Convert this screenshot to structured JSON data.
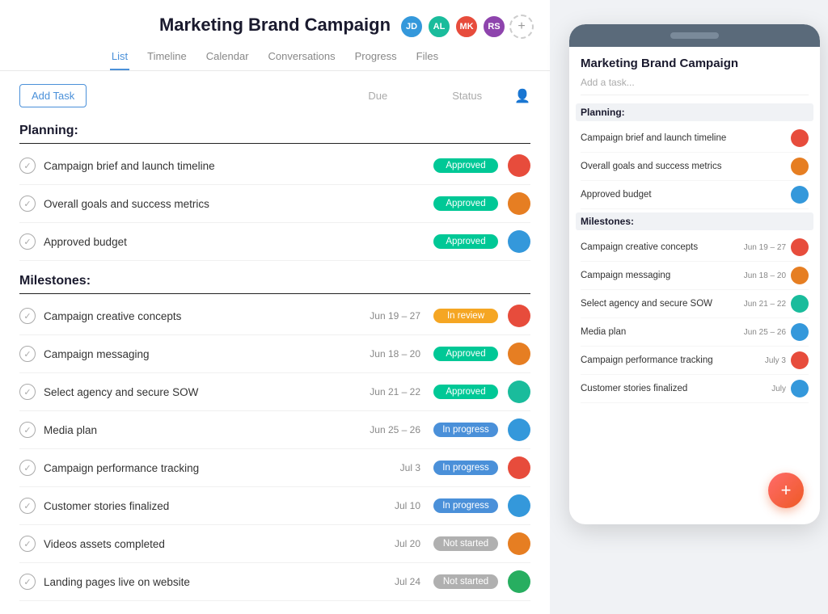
{
  "header": {
    "title": "Marketing Brand Campaign",
    "add_task_label": "Add Task",
    "col_due": "Due",
    "col_status": "Status"
  },
  "tabs": [
    {
      "label": "List",
      "active": true
    },
    {
      "label": "Timeline",
      "active": false
    },
    {
      "label": "Calendar",
      "active": false
    },
    {
      "label": "Conversations",
      "active": false
    },
    {
      "label": "Progress",
      "active": false
    },
    {
      "label": "Files",
      "active": false
    }
  ],
  "sections": [
    {
      "title": "Planning:",
      "tasks": [
        {
          "name": "Campaign brief and launch timeline",
          "due": "",
          "status": "Approved",
          "status_class": "badge-approved",
          "avatar_color": "av-red"
        },
        {
          "name": "Overall goals and success metrics",
          "due": "",
          "status": "Approved",
          "status_class": "badge-approved",
          "avatar_color": "av-orange"
        },
        {
          "name": "Approved budget",
          "due": "",
          "status": "Approved",
          "status_class": "badge-approved",
          "avatar_color": "av-blue"
        }
      ]
    },
    {
      "title": "Milestones:",
      "tasks": [
        {
          "name": "Campaign creative concepts",
          "due": "Jun 19 – 27",
          "status": "In review",
          "status_class": "badge-inreview",
          "avatar_color": "av-red"
        },
        {
          "name": "Campaign messaging",
          "due": "Jun 18 – 20",
          "status": "Approved",
          "status_class": "badge-approved",
          "avatar_color": "av-orange"
        },
        {
          "name": "Select agency and secure SOW",
          "due": "Jun 21 – 22",
          "status": "Approved",
          "status_class": "badge-approved",
          "avatar_color": "av-teal"
        },
        {
          "name": "Media plan",
          "due": "Jun 25 – 26",
          "status": "In progress",
          "status_class": "badge-inprogress",
          "avatar_color": "av-blue"
        },
        {
          "name": "Campaign performance tracking",
          "due": "Jul 3",
          "status": "In progress",
          "status_class": "badge-inprogress",
          "avatar_color": "av-red"
        },
        {
          "name": "Customer stories finalized",
          "due": "Jul 10",
          "status": "In progress",
          "status_class": "badge-inprogress",
          "avatar_color": "av-blue"
        },
        {
          "name": "Videos assets completed",
          "due": "Jul 20",
          "status": "Not started",
          "status_class": "badge-notstarted",
          "avatar_color": "av-orange"
        },
        {
          "name": "Landing pages live on website",
          "due": "Jul 24",
          "status": "Not started",
          "status_class": "badge-notstarted",
          "avatar_color": "av-green"
        }
      ]
    }
  ],
  "mobile": {
    "title": "Marketing Brand Campaign",
    "add_task_placeholder": "Add a task...",
    "sections": [
      {
        "title": "Planning:",
        "tasks": [
          {
            "name": "Campaign brief and launch timeline",
            "due": "",
            "avatar_color": "av-red"
          },
          {
            "name": "Overall goals and success metrics",
            "due": "",
            "avatar_color": "av-orange"
          },
          {
            "name": "Approved budget",
            "due": "",
            "avatar_color": "av-blue"
          }
        ]
      },
      {
        "title": "Milestones:",
        "tasks": [
          {
            "name": "Campaign creative concepts",
            "due": "Jun 19 – 27",
            "avatar_color": "av-red"
          },
          {
            "name": "Campaign messaging",
            "due": "Jun 18 – 20",
            "avatar_color": "av-orange"
          },
          {
            "name": "Select agency and secure SOW",
            "due": "Jun 21 – 22",
            "avatar_color": "av-teal"
          },
          {
            "name": "Media plan",
            "due": "Jun 25 – 26",
            "avatar_color": "av-blue"
          },
          {
            "name": "Campaign performance tracking",
            "due": "July 3",
            "avatar_color": "av-red"
          },
          {
            "name": "Customer stories finalized",
            "due": "July",
            "avatar_color": "av-blue"
          }
        ]
      }
    ],
    "fab_label": "+"
  }
}
